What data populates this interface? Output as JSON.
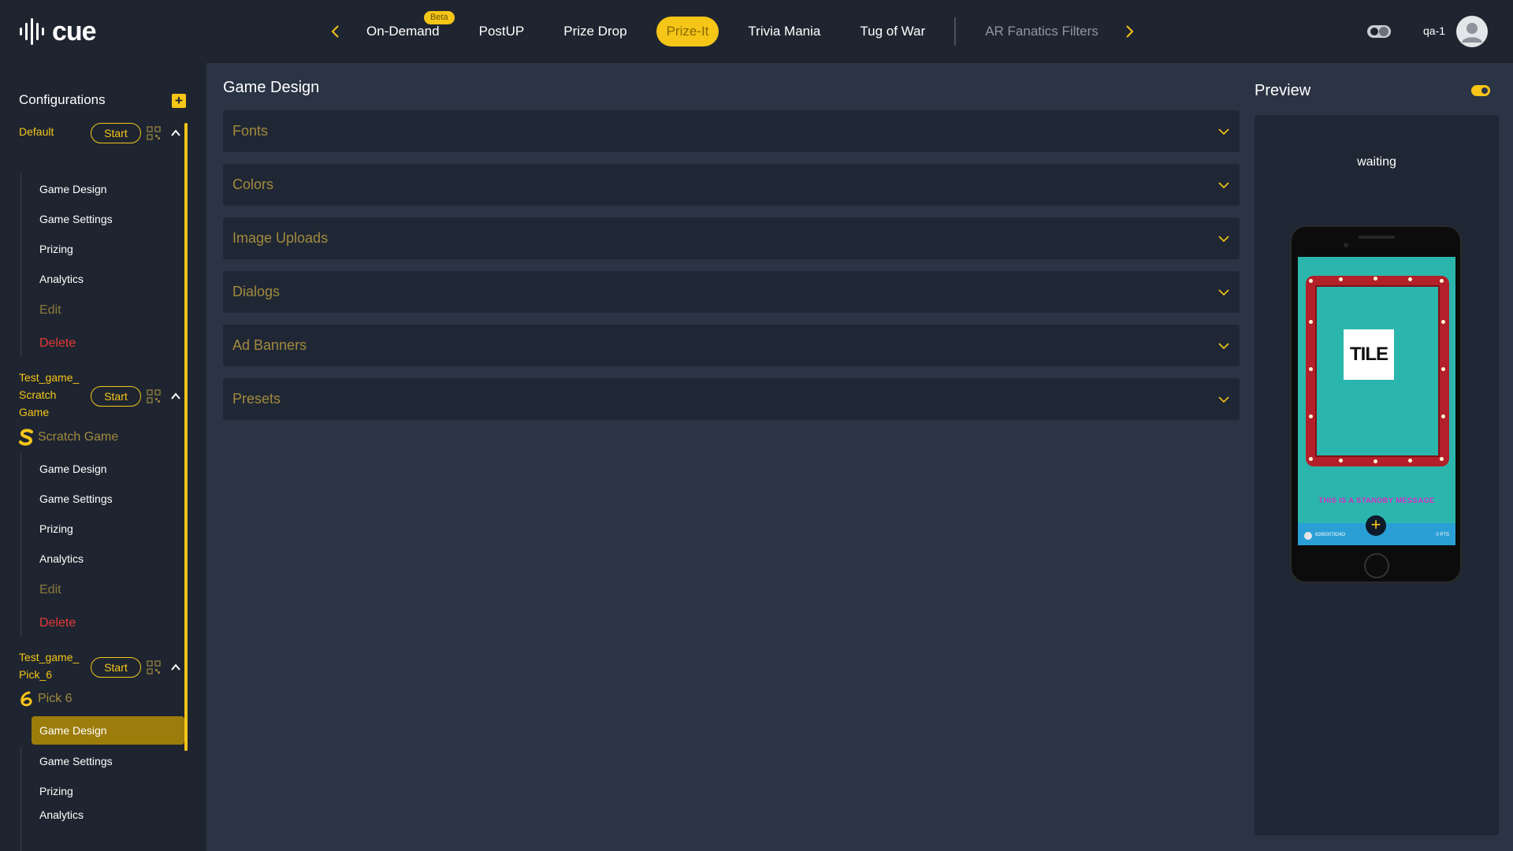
{
  "app": {
    "logo_text": "cue"
  },
  "nav": {
    "tabs": [
      {
        "label": "On-Demand",
        "badge": "Beta"
      },
      {
        "label": "PostUP"
      },
      {
        "label": "Prize Drop"
      },
      {
        "label": "Prize-It",
        "active": true
      },
      {
        "label": "Trivia Mania"
      },
      {
        "label": "Tug of War"
      },
      {
        "label": "AR Fanatics Filters"
      }
    ]
  },
  "user": {
    "name": "qa-1"
  },
  "sidebar": {
    "title": "Configurations",
    "start_label": "Start",
    "configs": [
      {
        "name_lines": [
          "Default"
        ],
        "items": [
          "Game Design",
          "Game Settings",
          "Prizing",
          "Analytics"
        ],
        "edit": "Edit",
        "delete": "Delete"
      },
      {
        "name_lines": [
          "Test_game_",
          "Scratch",
          "Game"
        ],
        "game_type": "Scratch Game",
        "items": [
          "Game Design",
          "Game Settings",
          "Prizing",
          "Analytics"
        ],
        "edit": "Edit",
        "delete": "Delete"
      },
      {
        "name_lines": [
          "Test_game_",
          "Pick_6"
        ],
        "game_type": "Pick 6",
        "items": [
          "Game Design",
          "Game Settings",
          "Prizing",
          "Analytics"
        ],
        "active_item": "Game Design"
      }
    ]
  },
  "main": {
    "title": "Game Design",
    "sections": [
      "Fonts",
      "Colors",
      "Image Uploads",
      "Dialogs",
      "Ad Banners",
      "Presets"
    ]
  },
  "preview": {
    "title": "Preview",
    "status": "waiting",
    "tile_text": "TILE",
    "standby_message": "THIS IS A STANDBY MESSAGE",
    "player_id": "6265007824O",
    "points": "0 PTS"
  },
  "colors": {
    "accent": "#f5c518",
    "danger": "#e53935",
    "background": "#1f2530",
    "panel": "#2b3445"
  }
}
